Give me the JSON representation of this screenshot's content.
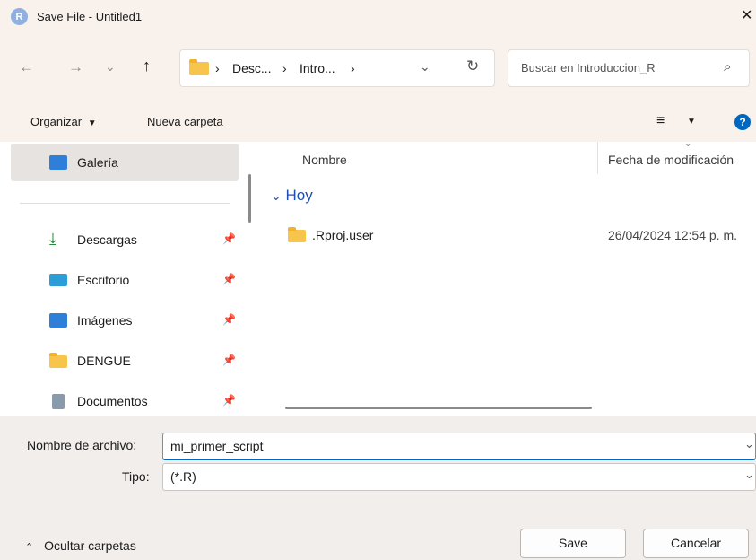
{
  "window": {
    "title": "Save File - Untitled1",
    "app_icon_letter": "R"
  },
  "breadcrumb": {
    "items": [
      "Desc...",
      "Intro..."
    ]
  },
  "search": {
    "placeholder": "Buscar en Introduccion_R"
  },
  "toolbar": {
    "organize_label": "Organizar",
    "new_folder_label": "Nueva carpeta"
  },
  "sidebar": {
    "gallery": "Galería",
    "items": [
      {
        "label": "Descargas",
        "icon": "download-icon"
      },
      {
        "label": "Escritorio",
        "icon": "desktop-icon"
      },
      {
        "label": "Imágenes",
        "icon": "images-icon"
      },
      {
        "label": "DENGUE",
        "icon": "folder-icon"
      },
      {
        "label": "Documentos",
        "icon": "documents-icon"
      }
    ]
  },
  "file_list": {
    "columns": {
      "name": "Nombre",
      "modified": "Fecha de modificación"
    },
    "group": "Hoy",
    "rows": [
      {
        "name": ".Rproj.user",
        "modified": "26/04/2024 12:54 p. m."
      }
    ]
  },
  "form": {
    "filename_label": "Nombre de archivo:",
    "filename_value": "mi_primer_script",
    "type_label": "Tipo:",
    "type_value": "(*.R)"
  },
  "footer": {
    "hide_folders_label": "Ocultar carpetas",
    "save_label": "Save",
    "cancel_label": "Cancelar"
  },
  "colors": {
    "accent": "#0067c0",
    "folder": "#f7c44c",
    "titlebar": "#f8f1ec"
  }
}
